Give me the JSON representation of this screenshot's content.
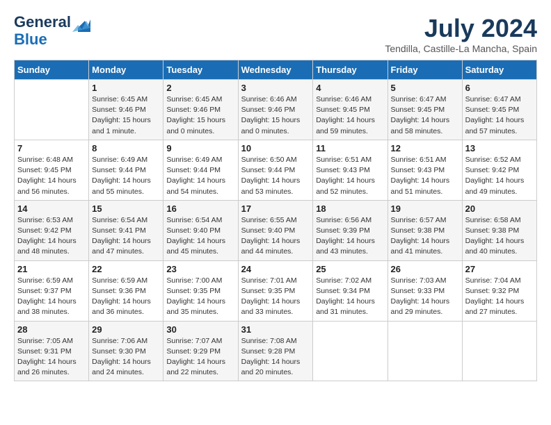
{
  "header": {
    "logo_line1": "General",
    "logo_line2": "Blue",
    "month_title": "July 2024",
    "location": "Tendilla, Castille-La Mancha, Spain"
  },
  "days_of_week": [
    "Sunday",
    "Monday",
    "Tuesday",
    "Wednesday",
    "Thursday",
    "Friday",
    "Saturday"
  ],
  "weeks": [
    [
      {
        "num": "",
        "info": ""
      },
      {
        "num": "1",
        "info": "Sunrise: 6:45 AM\nSunset: 9:46 PM\nDaylight: 15 hours\nand 1 minute."
      },
      {
        "num": "2",
        "info": "Sunrise: 6:45 AM\nSunset: 9:46 PM\nDaylight: 15 hours\nand 0 minutes."
      },
      {
        "num": "3",
        "info": "Sunrise: 6:46 AM\nSunset: 9:46 PM\nDaylight: 15 hours\nand 0 minutes."
      },
      {
        "num": "4",
        "info": "Sunrise: 6:46 AM\nSunset: 9:45 PM\nDaylight: 14 hours\nand 59 minutes."
      },
      {
        "num": "5",
        "info": "Sunrise: 6:47 AM\nSunset: 9:45 PM\nDaylight: 14 hours\nand 58 minutes."
      },
      {
        "num": "6",
        "info": "Sunrise: 6:47 AM\nSunset: 9:45 PM\nDaylight: 14 hours\nand 57 minutes."
      }
    ],
    [
      {
        "num": "7",
        "info": "Sunrise: 6:48 AM\nSunset: 9:45 PM\nDaylight: 14 hours\nand 56 minutes."
      },
      {
        "num": "8",
        "info": "Sunrise: 6:49 AM\nSunset: 9:44 PM\nDaylight: 14 hours\nand 55 minutes."
      },
      {
        "num": "9",
        "info": "Sunrise: 6:49 AM\nSunset: 9:44 PM\nDaylight: 14 hours\nand 54 minutes."
      },
      {
        "num": "10",
        "info": "Sunrise: 6:50 AM\nSunset: 9:44 PM\nDaylight: 14 hours\nand 53 minutes."
      },
      {
        "num": "11",
        "info": "Sunrise: 6:51 AM\nSunset: 9:43 PM\nDaylight: 14 hours\nand 52 minutes."
      },
      {
        "num": "12",
        "info": "Sunrise: 6:51 AM\nSunset: 9:43 PM\nDaylight: 14 hours\nand 51 minutes."
      },
      {
        "num": "13",
        "info": "Sunrise: 6:52 AM\nSunset: 9:42 PM\nDaylight: 14 hours\nand 49 minutes."
      }
    ],
    [
      {
        "num": "14",
        "info": "Sunrise: 6:53 AM\nSunset: 9:42 PM\nDaylight: 14 hours\nand 48 minutes."
      },
      {
        "num": "15",
        "info": "Sunrise: 6:54 AM\nSunset: 9:41 PM\nDaylight: 14 hours\nand 47 minutes."
      },
      {
        "num": "16",
        "info": "Sunrise: 6:54 AM\nSunset: 9:40 PM\nDaylight: 14 hours\nand 45 minutes."
      },
      {
        "num": "17",
        "info": "Sunrise: 6:55 AM\nSunset: 9:40 PM\nDaylight: 14 hours\nand 44 minutes."
      },
      {
        "num": "18",
        "info": "Sunrise: 6:56 AM\nSunset: 9:39 PM\nDaylight: 14 hours\nand 43 minutes."
      },
      {
        "num": "19",
        "info": "Sunrise: 6:57 AM\nSunset: 9:38 PM\nDaylight: 14 hours\nand 41 minutes."
      },
      {
        "num": "20",
        "info": "Sunrise: 6:58 AM\nSunset: 9:38 PM\nDaylight: 14 hours\nand 40 minutes."
      }
    ],
    [
      {
        "num": "21",
        "info": "Sunrise: 6:59 AM\nSunset: 9:37 PM\nDaylight: 14 hours\nand 38 minutes."
      },
      {
        "num": "22",
        "info": "Sunrise: 6:59 AM\nSunset: 9:36 PM\nDaylight: 14 hours\nand 36 minutes."
      },
      {
        "num": "23",
        "info": "Sunrise: 7:00 AM\nSunset: 9:35 PM\nDaylight: 14 hours\nand 35 minutes."
      },
      {
        "num": "24",
        "info": "Sunrise: 7:01 AM\nSunset: 9:35 PM\nDaylight: 14 hours\nand 33 minutes."
      },
      {
        "num": "25",
        "info": "Sunrise: 7:02 AM\nSunset: 9:34 PM\nDaylight: 14 hours\nand 31 minutes."
      },
      {
        "num": "26",
        "info": "Sunrise: 7:03 AM\nSunset: 9:33 PM\nDaylight: 14 hours\nand 29 minutes."
      },
      {
        "num": "27",
        "info": "Sunrise: 7:04 AM\nSunset: 9:32 PM\nDaylight: 14 hours\nand 27 minutes."
      }
    ],
    [
      {
        "num": "28",
        "info": "Sunrise: 7:05 AM\nSunset: 9:31 PM\nDaylight: 14 hours\nand 26 minutes."
      },
      {
        "num": "29",
        "info": "Sunrise: 7:06 AM\nSunset: 9:30 PM\nDaylight: 14 hours\nand 24 minutes."
      },
      {
        "num": "30",
        "info": "Sunrise: 7:07 AM\nSunset: 9:29 PM\nDaylight: 14 hours\nand 22 minutes."
      },
      {
        "num": "31",
        "info": "Sunrise: 7:08 AM\nSunset: 9:28 PM\nDaylight: 14 hours\nand 20 minutes."
      },
      {
        "num": "",
        "info": ""
      },
      {
        "num": "",
        "info": ""
      },
      {
        "num": "",
        "info": ""
      }
    ]
  ]
}
